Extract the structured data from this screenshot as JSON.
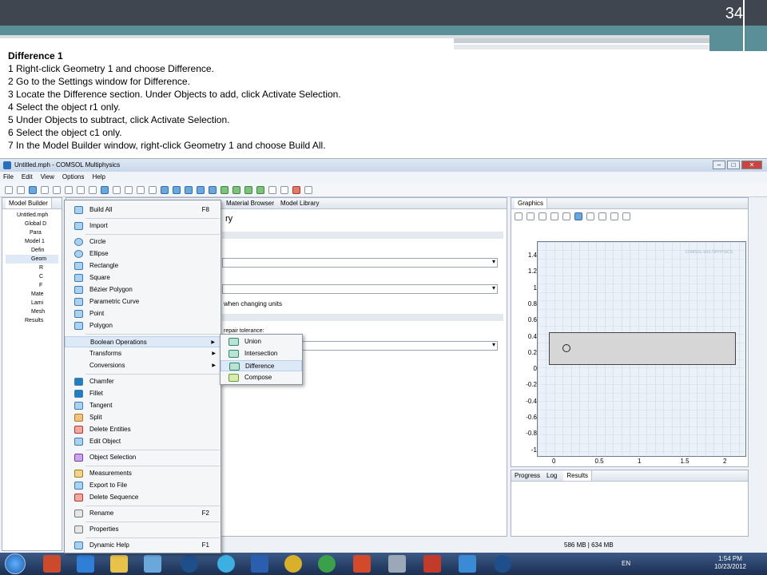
{
  "slide": {
    "number": "34",
    "heading": "Difference 1",
    "steps": [
      "1  Right-click Geometry 1 and choose Difference.",
      "2  Go to the Settings window for Difference.",
      "3  Locate the Difference section. Under Objects to add, click Activate Selection.",
      "4  Select the object r1 only.",
      "5  Under Objects to subtract, click Activate Selection.",
      "6  Select the object c1 only.",
      "7  In the Model Builder window, right-click Geometry 1 and choose Build All."
    ]
  },
  "window": {
    "title": "Untitled.mph - COMSOL Multiphysics",
    "menu": [
      "File",
      "Edit",
      "View",
      "Options",
      "Help"
    ]
  },
  "model_builder": {
    "tab": "Model Builder",
    "tree": [
      "Untitled.mph",
      "Global D",
      "Para",
      "Model 1",
      "Defin",
      "Geom",
      "R",
      "C",
      "F",
      "Mate",
      "Lami",
      "Mesh",
      "Results"
    ]
  },
  "settings": {
    "tabs": [
      "Material Browser",
      "Model Library"
    ],
    "title_fragment": "ry",
    "units_text": "when changing units",
    "tolerance_text": "repair tolerance:"
  },
  "context_menu": {
    "items": [
      {
        "label": "Build All",
        "shortcut": "F8"
      },
      {
        "label": "Import"
      },
      {
        "label": "Circle"
      },
      {
        "label": "Ellipse"
      },
      {
        "label": "Rectangle"
      },
      {
        "label": "Square"
      },
      {
        "label": "Bézier Polygon"
      },
      {
        "label": "Parametric Curve"
      },
      {
        "label": "Point"
      },
      {
        "label": "Polygon"
      },
      {
        "label": "Boolean Operations"
      },
      {
        "label": "Transforms"
      },
      {
        "label": "Conversions"
      },
      {
        "label": "Chamfer"
      },
      {
        "label": "Fillet"
      },
      {
        "label": "Tangent"
      },
      {
        "label": "Split"
      },
      {
        "label": "Delete Entities"
      },
      {
        "label": "Edit Object"
      },
      {
        "label": "Object Selection"
      },
      {
        "label": "Measurements"
      },
      {
        "label": "Export to File"
      },
      {
        "label": "Delete Sequence"
      },
      {
        "label": "Rename",
        "shortcut": "F2"
      },
      {
        "label": "Properties"
      },
      {
        "label": "Dynamic Help",
        "shortcut": "F1"
      }
    ]
  },
  "boolean_submenu": {
    "items": [
      "Union",
      "Intersection",
      "Difference",
      "Compose"
    ]
  },
  "graphics": {
    "tab": "Graphics",
    "watermark": "COMSOL MULTIPHYSICS",
    "y_ticks": [
      "1.4",
      "1.2",
      "1",
      "0.8",
      "0.6",
      "0.4",
      "0.2",
      "0",
      "-0.2",
      "-0.4",
      "-0.6",
      "-0.8",
      "-1"
    ],
    "x_ticks": [
      "0",
      "0.5",
      "1",
      "1.5",
      "2"
    ]
  },
  "bottom_panel": {
    "tabs": [
      "Progress",
      "Log",
      "Results"
    ]
  },
  "status": {
    "memory": "586 MB | 634 MB"
  },
  "taskbar": {
    "lang": "EN",
    "time": "1:54 PM",
    "date": "10/23/2012"
  }
}
